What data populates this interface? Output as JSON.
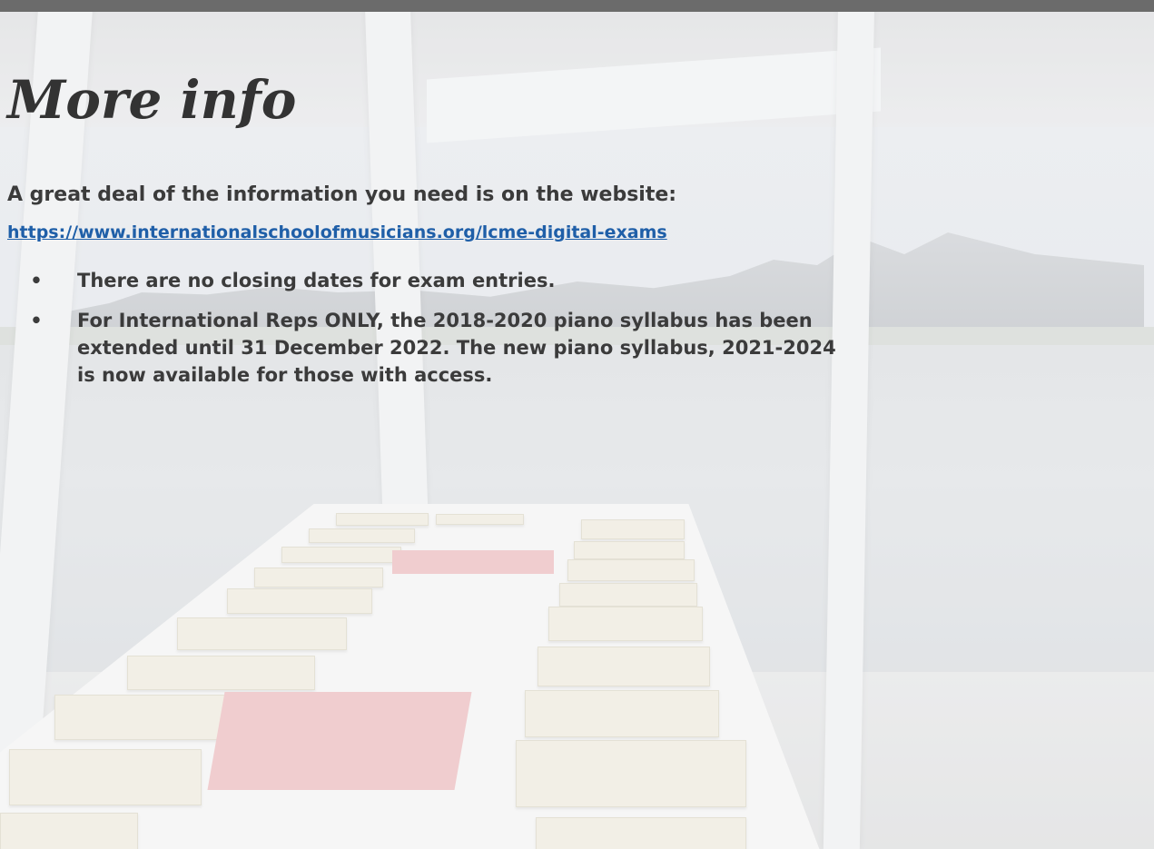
{
  "slide": {
    "title": "More info",
    "intro": "A great deal of the information you need is on the website:",
    "link": "https://www.internationalschoolofmusicians.org/lcme-digital-exams",
    "bullet_glyph": "•",
    "bullets": [
      "There are no closing dates for exam entries.",
      "For International Reps ONLY, the 2018-2020 piano syllabus has been extended until 31 December 2022. The new piano syllabus, 2021-2024 is now available for those with access."
    ]
  },
  "colors": {
    "top_bar": "#6b6b6b",
    "title": "#333333",
    "body_text": "#3b3b3b",
    "link": "#1f5fa8"
  }
}
